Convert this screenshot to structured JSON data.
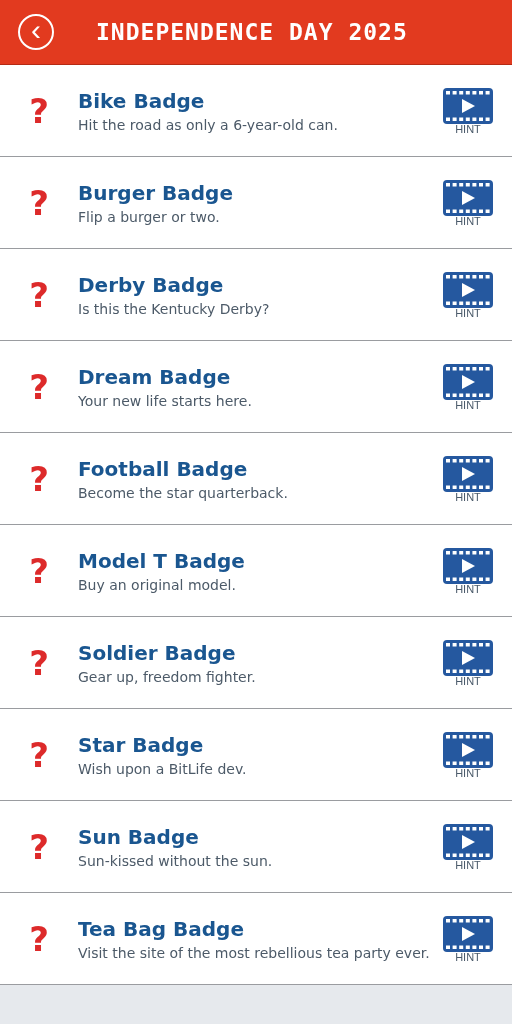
{
  "header": {
    "back": "‹",
    "title": "INDEPENDENCE DAY 2025"
  },
  "badges": [
    {
      "icon": "?",
      "name": "Bike Badge",
      "description": "Hit the road as only a 6-year-old can.",
      "hint": "HINT"
    },
    {
      "icon": "?",
      "name": "Burger Badge",
      "description": "Flip a burger or two.",
      "hint": "HINT"
    },
    {
      "icon": "?",
      "name": "Derby Badge",
      "description": "Is this the Kentucky Derby?",
      "hint": "HINT"
    },
    {
      "icon": "?",
      "name": "Dream Badge",
      "description": "Your new life starts here.",
      "hint": "HINT"
    },
    {
      "icon": "?",
      "name": "Football Badge",
      "description": "Become the star quarterback.",
      "hint": "HINT"
    },
    {
      "icon": "?",
      "name": "Model T Badge",
      "description": "Buy an original model.",
      "hint": "HINT"
    },
    {
      "icon": "?",
      "name": "Soldier Badge",
      "description": "Gear up, freedom fighter.",
      "hint": "HINT"
    },
    {
      "icon": "?",
      "name": "Star Badge",
      "description": "Wish upon a BitLife dev.",
      "hint": "HINT"
    },
    {
      "icon": "?",
      "name": "Sun Badge",
      "description": "Sun-kissed without the sun.",
      "hint": "HINT"
    },
    {
      "icon": "?",
      "name": "Tea Bag Badge",
      "description": "Visit the site of the most rebellious tea party ever.",
      "hint": "HINT"
    }
  ]
}
